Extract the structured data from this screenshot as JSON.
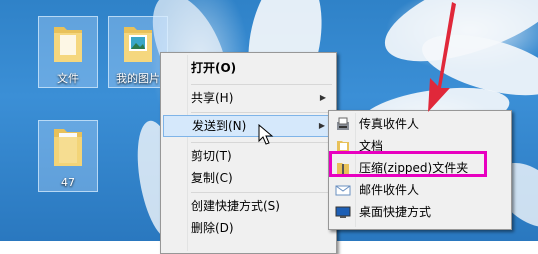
{
  "desktop": {
    "icons": [
      {
        "label": "文件"
      },
      {
        "label": "我的图片"
      },
      {
        "label": "47"
      }
    ]
  },
  "context_menu": {
    "items": [
      {
        "label": "打开(O)"
      },
      {
        "label": "共享(H)"
      },
      {
        "label": "发送到(N)"
      },
      {
        "label": "剪切(T)"
      },
      {
        "label": "复制(C)"
      },
      {
        "label": "创建快捷方式(S)"
      },
      {
        "label": "删除(D)"
      }
    ]
  },
  "send_to_menu": {
    "items": [
      {
        "label": "传真收件人",
        "icon": "fax-icon"
      },
      {
        "label": "文档",
        "icon": "documents-icon"
      },
      {
        "label": "压缩(zipped)文件夹",
        "icon": "zip-folder-icon"
      },
      {
        "label": "邮件收件人",
        "icon": "mail-icon"
      },
      {
        "label": "桌面快捷方式",
        "icon": "desktop-icon"
      }
    ]
  },
  "colors": {
    "highlight_box": "#e800c0",
    "arrow": "#e0283a"
  }
}
